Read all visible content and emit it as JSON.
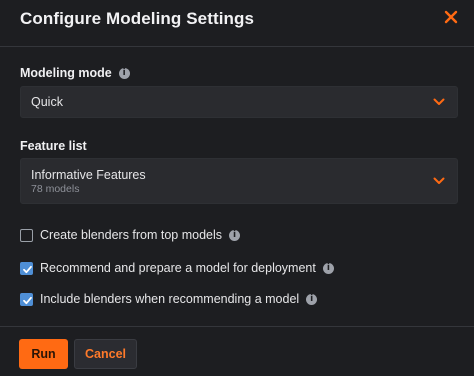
{
  "dialog": {
    "title": "Configure Modeling Settings"
  },
  "modeling_mode": {
    "label": "Modeling mode",
    "value": "Quick"
  },
  "feature_list": {
    "label": "Feature list",
    "value": "Informative Features",
    "subtext": "78 models"
  },
  "options": [
    {
      "label": "Create blenders from top models",
      "checked": false
    },
    {
      "label": "Recommend and prepare a model for deployment",
      "checked": true
    },
    {
      "label": "Include blenders when recommending a model",
      "checked": true
    }
  ],
  "buttons": {
    "run": "Run",
    "cancel": "Cancel"
  },
  "colors": {
    "accent": "#ff6a13",
    "checkbox": "#4f8fd6",
    "background": "#1d1e21"
  },
  "icons": {
    "close": "close-icon",
    "info": "info-icon",
    "chevron": "chevron-down-icon",
    "check": "check-icon"
  }
}
